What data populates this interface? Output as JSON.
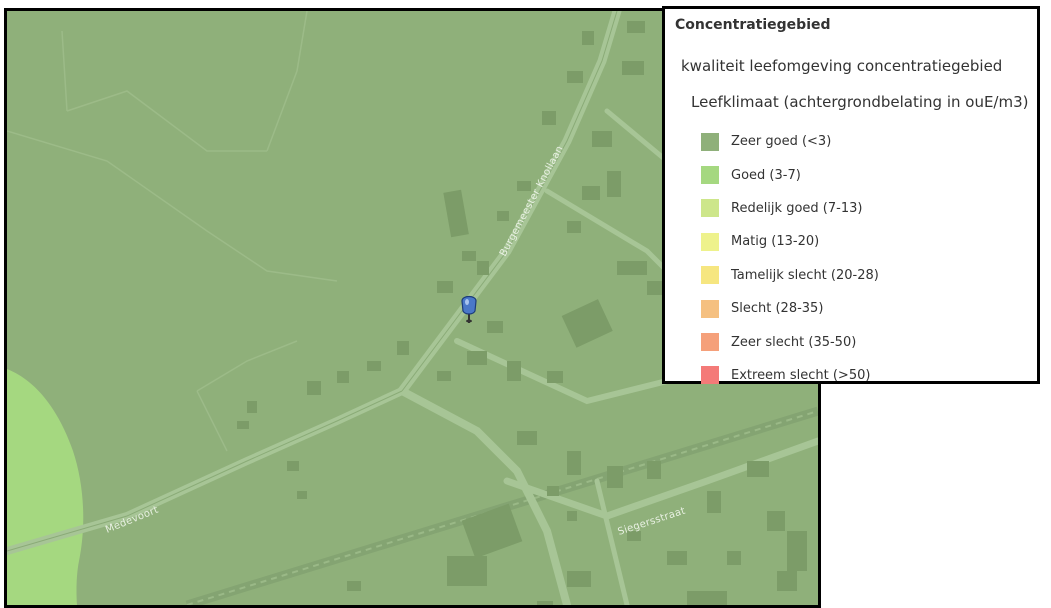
{
  "map": {
    "roads": [
      "Burgemeester Knollaan",
      "Medevoort",
      "Siegersstraat"
    ],
    "marker": "map-pin-icon"
  },
  "legend": {
    "title": "Concentratiegebied",
    "layer_name": "kwaliteit leefomgeving concentratiegebied",
    "field_name": "Leefklimaat (achtergrondbelating in ouE/m3)",
    "classes": [
      {
        "label": "Zeer goed (<3)",
        "color": "#8fb07a"
      },
      {
        "label": "Goed (3-7)",
        "color": "#a5d880"
      },
      {
        "label": "Redelijk goed (7-13)",
        "color": "#cde68a"
      },
      {
        "label": "Matig (13-20)",
        "color": "#eef28c"
      },
      {
        "label": "Tamelijk slecht (20-28)",
        "color": "#f6e680"
      },
      {
        "label": "Slecht (28-35)",
        "color": "#f5c080"
      },
      {
        "label": "Zeer slecht (35-50)",
        "color": "#f5a07a"
      },
      {
        "label": "Extreem slecht (>50)",
        "color": "#f47a78"
      }
    ]
  }
}
